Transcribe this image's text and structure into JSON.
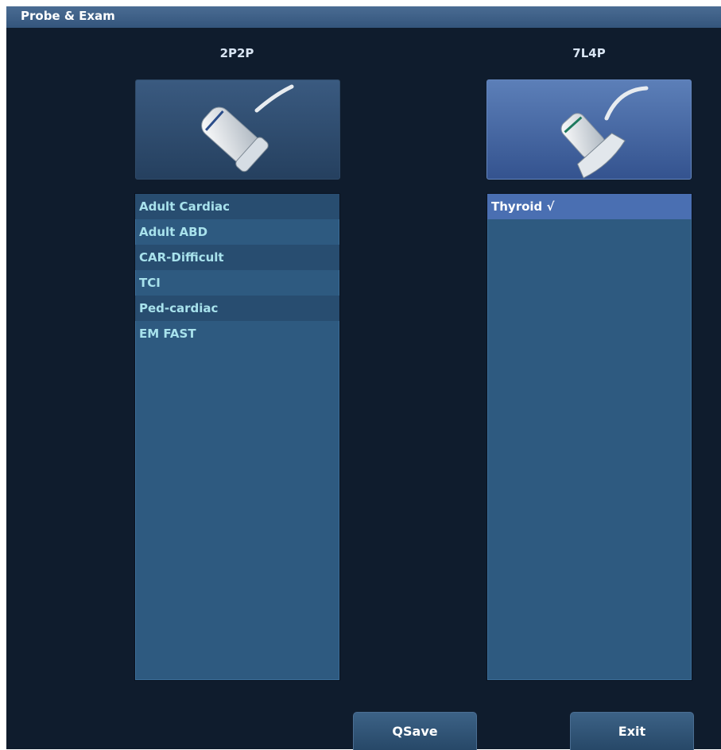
{
  "window": {
    "title": "Probe & Exam"
  },
  "probes": [
    {
      "name": "2P2P",
      "icon": "phased-array-probe-icon",
      "exams": [
        {
          "label": "Adult Cardiac",
          "selected": false
        },
        {
          "label": "Adult ABD",
          "selected": false
        },
        {
          "label": "CAR-Difficult",
          "selected": false
        },
        {
          "label": "TCI",
          "selected": false
        },
        {
          "label": "Ped-cardiac",
          "selected": false
        },
        {
          "label": "EM FAST",
          "selected": false
        }
      ]
    },
    {
      "name": "7L4P",
      "icon": "linear-probe-icon",
      "selected": true,
      "exams": [
        {
          "label": "Thyroid √",
          "selected": true
        }
      ]
    }
  ],
  "buttons": {
    "qsave": "QSave",
    "exit": "Exit"
  },
  "colors": {
    "background": "#0f1c2d",
    "list_background": "#2e5a80",
    "selected_item": "#4a6fb2",
    "item_text": "#a8e2ec"
  }
}
